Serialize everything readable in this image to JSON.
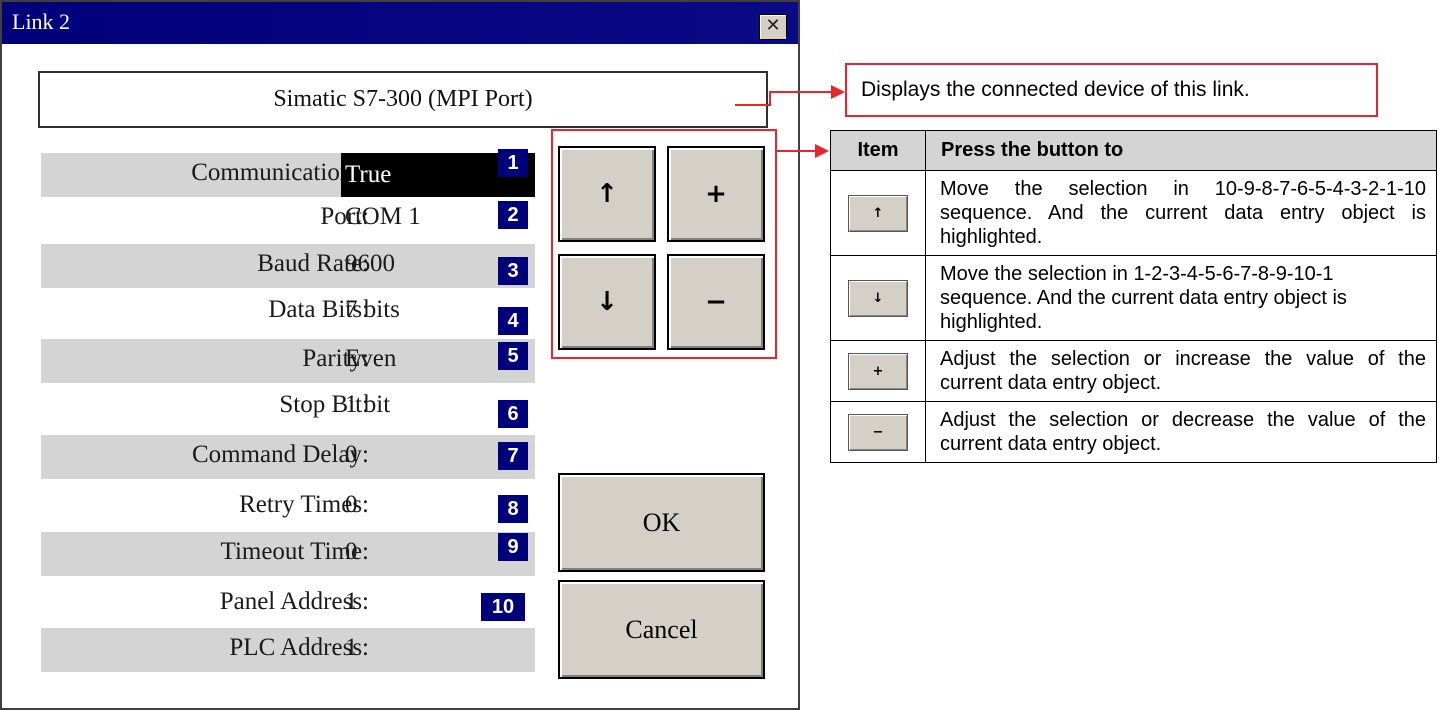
{
  "dialog": {
    "title": "Link 2",
    "close_glyph": "✕",
    "device": "Simatic S7-300 (MPI Port)",
    "fields": [
      {
        "label": "Communications:",
        "value": "True",
        "num": "1"
      },
      {
        "label": "Port:",
        "value": "COM 1",
        "num": "2"
      },
      {
        "label": "Baud Rate:",
        "value": "9600",
        "num": "3"
      },
      {
        "label": "Data Bits:",
        "value": "7 bits",
        "num": "4"
      },
      {
        "label": "Parity:",
        "value": "Even",
        "num": "5"
      },
      {
        "label": "Stop Bit:",
        "value": "1 bit",
        "num": "6"
      },
      {
        "label": "Command Delay:",
        "value": "0",
        "num": "7"
      },
      {
        "label": "Retry Times:",
        "value": "0",
        "num": "8"
      },
      {
        "label": "Timeout Time:",
        "value": "0",
        "num": "9"
      },
      {
        "label": "Panel Address:",
        "value": "1",
        "num": "10"
      },
      {
        "label": "PLC Address:",
        "value": "1",
        "num": ""
      }
    ],
    "buttons": {
      "up": "↑",
      "down": "↓",
      "plus": "+",
      "minus": "−",
      "ok": "OK",
      "cancel": "Cancel"
    }
  },
  "callout": "Displays the connected device of this link.",
  "help_table": {
    "header_item": "Item",
    "header_desc": "Press the button to",
    "rows": [
      {
        "icon": "↑",
        "text": "Move the selection in 10-9-8-7-6-5-4-3-2-1-10 sequence. And the current data entry object is highlighted."
      },
      {
        "icon": "↓",
        "text": "Move the selection in 1-2-3-4-5-6-7-8-9-10-1 sequence. And the current data entry object is highlighted."
      },
      {
        "icon": "+",
        "text": "Adjust the selection or increase the value of the current data entry object."
      },
      {
        "icon": "−",
        "text": "Adjust the selection or decrease the value of the current data entry object."
      }
    ]
  },
  "colors": {
    "titlebar": "#00007a",
    "annotation_red": "#e8262b",
    "number_badge": "#00007a",
    "row_shade": "#d4d4d4"
  }
}
